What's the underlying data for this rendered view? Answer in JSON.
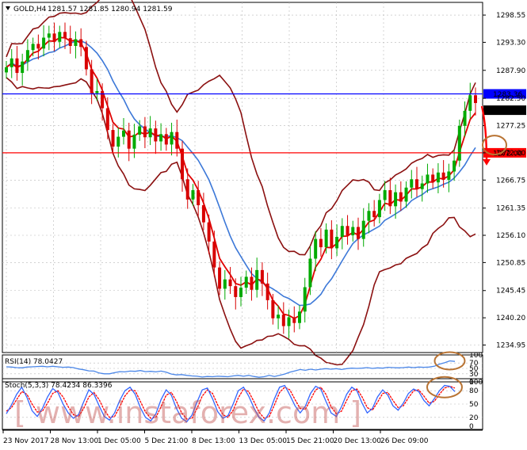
{
  "header": {
    "symbol": "GOLD,H4",
    "ohlc": "1281.57 1281.85 1280.94 1281.59"
  },
  "colors": {
    "background": "#ffffff",
    "axis": "#000000",
    "grid": "#b8b8b8",
    "candle_up": "#00aa00",
    "candle_down": "#d80000",
    "ema_fast": "#e00000",
    "ma_slow": "#3c78d8",
    "bollinger": "#8b1010",
    "resistance": "#0000ff",
    "support": "#ff0000",
    "rsi": "#4a86e8",
    "stoch_main": "#3366ff",
    "stoch_signal": "#ff0000",
    "circle": "#b87333",
    "watermark": "#c0504d"
  },
  "watermark": "[ www.instaforex.com ]",
  "chart_data": [
    {
      "type": "candlestick",
      "panel": "price",
      "title": "GOLD,H4",
      "ylim": [
        1233.5,
        1301.0
      ],
      "y_ticks": [
        "1298.55",
        "1293.30",
        "1287.90",
        "1282.50",
        "1277.25",
        "1272.00",
        "1266.75",
        "1261.35",
        "1256.10",
        "1250.85",
        "1245.45",
        "1240.20",
        "1234.95"
      ],
      "y_tick_values": [
        1298.55,
        1293.3,
        1287.9,
        1282.5,
        1277.25,
        1272.0,
        1266.75,
        1261.35,
        1256.1,
        1250.85,
        1245.45,
        1240.2,
        1234.95
      ],
      "horizontal_lines": [
        {
          "name": "resistance",
          "value": 1283.36,
          "label": "1283.36",
          "color": "#0000ff"
        },
        {
          "name": "support",
          "value": 1272.0,
          "label": "1272.00",
          "color": "#ff0000"
        }
      ],
      "current_price": {
        "value": 1281.59,
        "label": "1281.59"
      },
      "x_labels": [
        "23 Nov 2017",
        "28 Nov 13:00",
        "1 Dec 05:00",
        "5 Dec 21:00",
        "8 Dec 13:00",
        "13 Dec 05:00",
        "15 Dec 21:00",
        "20 Dec 13:00",
        "26 Dec 09:00"
      ],
      "close": [
        1288.5,
        1290.2,
        1287.4,
        1289.6,
        1291.8,
        1293.0,
        1292.1,
        1294.2,
        1295.0,
        1293.4,
        1295.3,
        1294.1,
        1292.6,
        1293.9,
        1292.4,
        1288.1,
        1283.5,
        1283.9,
        1280.6,
        1276.4,
        1273.2,
        1275.1,
        1276.3,
        1272.8,
        1275.5,
        1277.1,
        1275.0,
        1276.7,
        1274.2,
        1275.6,
        1273.6,
        1276.0,
        1272.8,
        1266.9,
        1263.0,
        1264.8,
        1261.9,
        1258.6,
        1254.9,
        1249.9,
        1245.8,
        1247.6,
        1246.3,
        1244.2,
        1246.0,
        1248.1,
        1245.6,
        1249.4,
        1246.8,
        1243.6,
        1240.1,
        1240.8,
        1238.6,
        1240.3,
        1239.2,
        1241.4,
        1246.1,
        1251.6,
        1255.4,
        1253.8,
        1257.2,
        1253.6,
        1255.8,
        1257.9,
        1256.1,
        1257.7,
        1255.4,
        1258.9,
        1260.8,
        1259.6,
        1262.9,
        1264.8,
        1261.7,
        1264.4,
        1262.6,
        1265.3,
        1266.9,
        1265.0,
        1266.1,
        1267.8,
        1266.3,
        1268.2,
        1266.8,
        1268.4,
        1270.5,
        1277.2,
        1280.1,
        1283.1,
        1281.6
      ],
      "series": [
        {
          "name": "EMA",
          "color": "#e00000"
        },
        {
          "name": "MA",
          "color": "#3c78d8"
        },
        {
          "name": "Bollinger Upper",
          "color": "#8b1010"
        },
        {
          "name": "Bollinger Lower",
          "color": "#8b1010"
        }
      ],
      "annotation": {
        "type": "arrow-down",
        "value": 1272.0
      },
      "circle_value": 1273.5
    },
    {
      "type": "line",
      "panel": "rsi",
      "label": "RSI(14) 78.0427",
      "ylim": [
        0,
        100
      ],
      "y_ticks": [
        "100",
        "70",
        "50",
        "30",
        "0"
      ],
      "values": [
        56,
        55,
        53,
        52,
        55,
        56,
        57,
        58,
        56,
        58,
        56,
        54,
        55,
        53,
        48,
        45,
        41,
        40,
        33,
        30,
        30,
        34,
        38,
        37,
        40,
        39,
        42,
        38,
        39,
        37,
        40,
        36,
        29,
        26,
        27,
        24,
        22,
        21,
        18,
        20,
        19,
        21,
        20,
        19,
        22,
        24,
        21,
        24,
        20,
        17,
        19,
        24,
        20,
        24,
        29,
        36,
        41,
        46,
        43,
        47,
        44,
        47,
        49,
        47,
        49,
        46,
        49,
        51,
        50,
        51,
        53,
        50,
        52,
        51,
        54,
        53,
        52,
        53,
        55,
        53,
        55,
        54,
        55,
        58,
        66,
        71,
        78,
        76
      ],
      "circle_value": 78
    },
    {
      "type": "line",
      "panel": "stochastic",
      "label": "Stoch(5,3,3) 78.4234 86.3396",
      "ylim": [
        0,
        100
      ],
      "y_ticks": [
        "100",
        "80",
        "50",
        "20",
        "0"
      ],
      "main": [
        28,
        48,
        72,
        88,
        65,
        35,
        22,
        40,
        66,
        85,
        76,
        50,
        30,
        18,
        26,
        55,
        82,
        72,
        46,
        22,
        14,
        30,
        58,
        80,
        88,
        72,
        42,
        20,
        12,
        28,
        60,
        82,
        70,
        40,
        18,
        10,
        25,
        55,
        82,
        86,
        62,
        33,
        18,
        24,
        50,
        80,
        88,
        68,
        42,
        20,
        12,
        30,
        62,
        88,
        92,
        70,
        46,
        30,
        45,
        74,
        90,
        84,
        56,
        30,
        22,
        44,
        72,
        88,
        80,
        52,
        30,
        40,
        66,
        82,
        70,
        46,
        36,
        52,
        74,
        84,
        78,
        58,
        46,
        62,
        80,
        92,
        90,
        78
      ],
      "signal": [
        34,
        42,
        60,
        78,
        72,
        50,
        32,
        34,
        52,
        74,
        80,
        66,
        44,
        26,
        22,
        40,
        66,
        76,
        60,
        36,
        20,
        22,
        44,
        68,
        82,
        80,
        56,
        32,
        18,
        20,
        44,
        70,
        76,
        56,
        30,
        16,
        18,
        40,
        68,
        82,
        74,
        48,
        26,
        20,
        36,
        64,
        84,
        78,
        56,
        32,
        18,
        22,
        48,
        76,
        88,
        82,
        60,
        40,
        38,
        60,
        82,
        88,
        72,
        44,
        28,
        34,
        58,
        80,
        84,
        66,
        42,
        36,
        54,
        74,
        76,
        58,
        42,
        46,
        64,
        80,
        82,
        68,
        52,
        56,
        72,
        86,
        90,
        86
      ],
      "circle_value": 88
    }
  ]
}
